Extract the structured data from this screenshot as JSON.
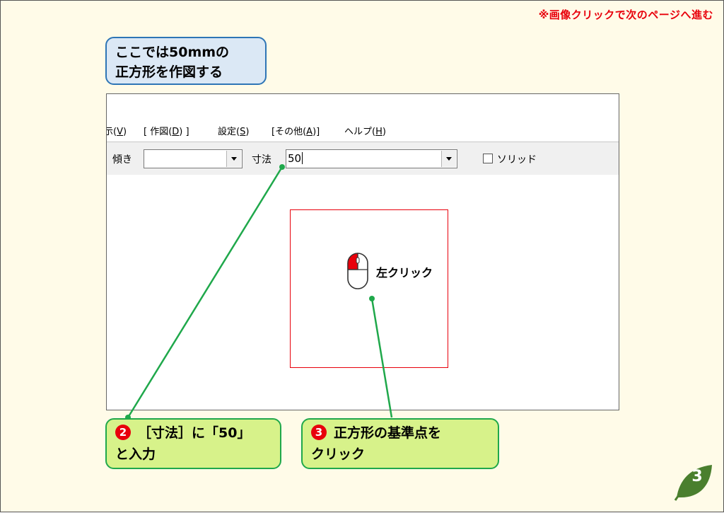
{
  "top_note": "※画像クリックで次のページへ進む",
  "intro_callout": "ここでは50mmの\n正方形を作図する",
  "menu": {
    "items": [
      {
        "pre": "示(",
        "key": "V",
        "post": ")"
      },
      {
        "pre": "[ 作図(",
        "key": "D",
        "post": ") ]"
      },
      {
        "pre": "設定(",
        "key": "S",
        "post": ")"
      },
      {
        "pre": "[その他(",
        "key": "A",
        "post": ")]"
      },
      {
        "pre": "ヘルプ(",
        "key": "H",
        "post": ")"
      }
    ]
  },
  "toolbar": {
    "angle_label": "傾き",
    "angle_value": "",
    "size_label": "寸法",
    "size_value": "50",
    "solid_label": "ソリッド",
    "solid_checked": false
  },
  "canvas": {
    "mouse_label": "左クリック"
  },
  "step2": {
    "number": "❷",
    "line1": "［寸法］に「50」",
    "line2": "と入力"
  },
  "step3": {
    "number": "❸",
    "line1": "正方形の基準点を",
    "line2": "クリック"
  },
  "page_number": "3",
  "colors": {
    "accent_red": "#e8000b",
    "green": "#1fa84b",
    "blue": "#2e75b6",
    "page_bg": "#fffbe8"
  }
}
